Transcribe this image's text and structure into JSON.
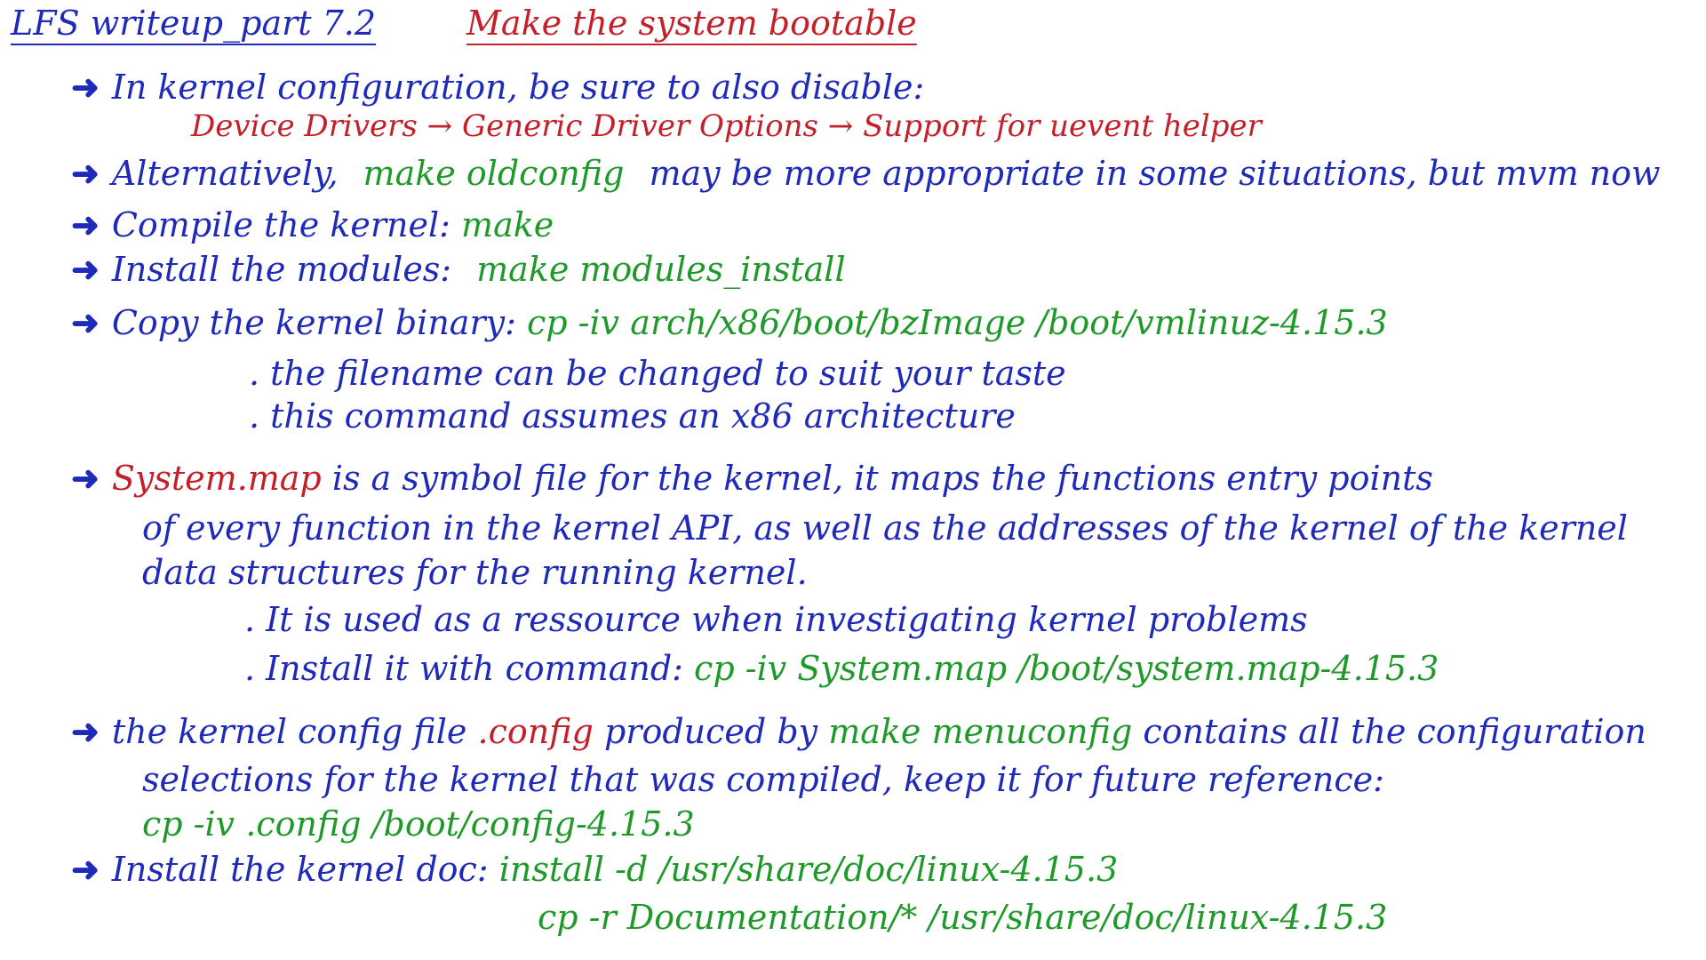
{
  "header": {
    "title": "LFS writeup_part 7.2",
    "subtitle": "Make the system bootable"
  },
  "lines": {
    "l1": {
      "text": "In kernel configuration, be sure to also disable:",
      "path": "Device Drivers → Generic Driver Options → Support for uevent helper"
    },
    "l2": {
      "prefix": "Alternatively,",
      "cmd": "make oldconfig",
      "suffix": "may be more appropriate in some situations, but mvm now"
    },
    "l3": {
      "prefix": "Compile the kernel:",
      "cmd": "make"
    },
    "l4": {
      "prefix": "Install the modules:",
      "cmd": "make modules_install"
    },
    "l5": {
      "prefix": "Copy the kernel binary:",
      "cmd": "cp -iv arch/x86/boot/bzImage /boot/vmlinuz-4.15.3",
      "sub1": ". the filename can be changed to suit your taste",
      "sub2": ". this command assumes an x86 architecture"
    },
    "l6": {
      "term": "System.map",
      "text1": "is a symbol file for the kernel, it maps the functions entry points",
      "text2": "of every function in the kernel API, as well as the addresses of the kernel of the kernel",
      "text3": "data structures for the running kernel.",
      "sub1": ". It is used as a ressource when investigating kernel problems",
      "sub2_prefix": ". Install it with command:",
      "sub2_cmd": "cp -iv System.map /boot/system.map-4.15.3"
    },
    "l7": {
      "prefix": "the kernel config file",
      "term": ".config",
      "mid": "produced by",
      "cmd": "make menuconfig",
      "suffix": "contains all the configuration",
      "text2": "selections for the kernel that was compiled, keep it for future reference:",
      "cmd2": "cp -iv .config /boot/config-4.15.3"
    },
    "l8": {
      "prefix": "Install the kernel doc:",
      "cmd": "install -d /usr/share/doc/linux-4.15.3",
      "cmd2": "cp -r Documentation/* /usr/share/doc/linux-4.15.3"
    }
  },
  "colors": {
    "blue": "#1f2bb8",
    "red": "#c3202a",
    "green": "#1f9a2a"
  }
}
